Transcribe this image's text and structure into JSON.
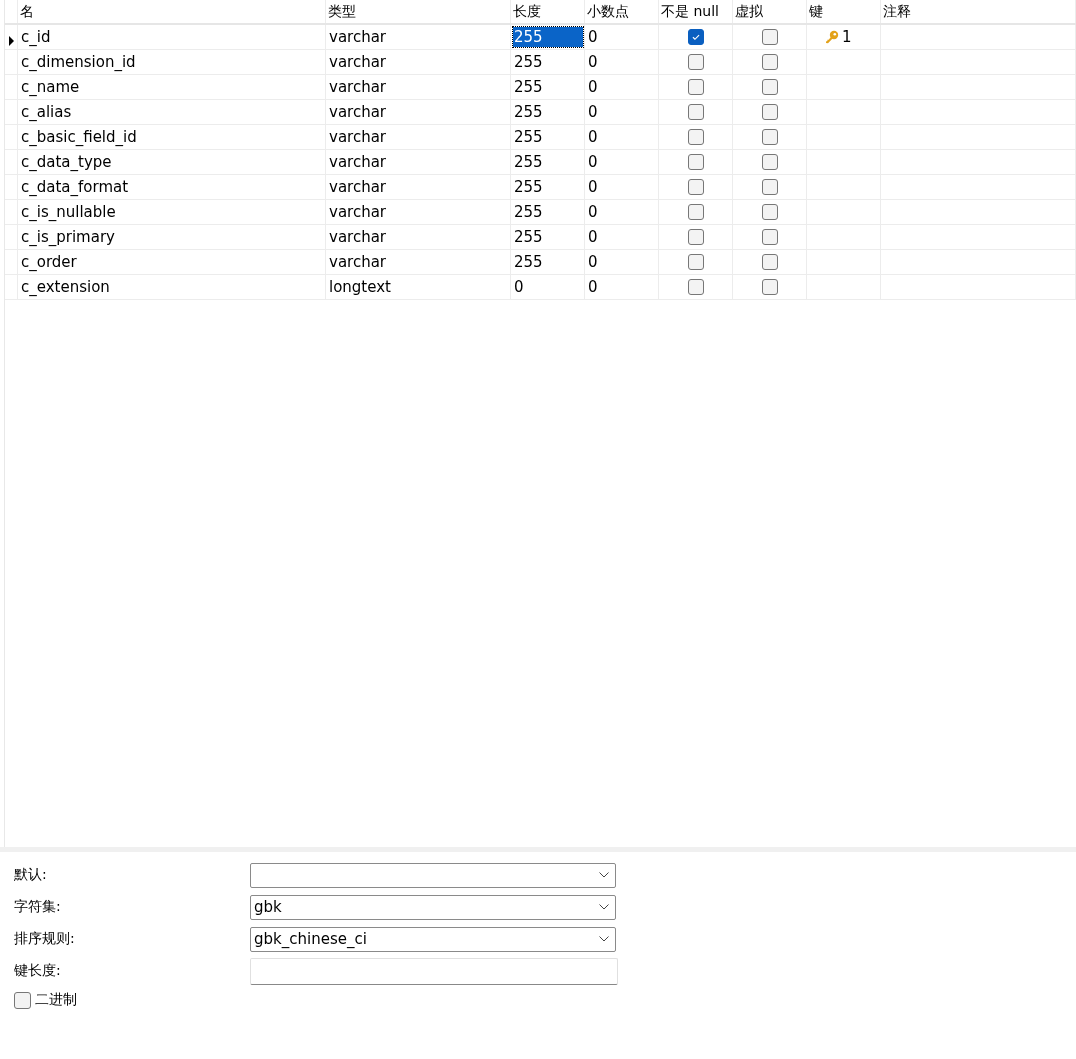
{
  "table": {
    "columns": [
      "名",
      "类型",
      "长度",
      "小数点",
      "不是 null",
      "虚拟",
      "键",
      "注释"
    ],
    "rows": [
      {
        "name": "c_id",
        "type": "varchar",
        "length": "255",
        "decimals": "0",
        "not_null": true,
        "virtual": false,
        "key": "1",
        "selected": true
      },
      {
        "name": "c_dimension_id",
        "type": "varchar",
        "length": "255",
        "decimals": "0",
        "not_null": false,
        "virtual": false,
        "selected": false
      },
      {
        "name": "c_name",
        "type": "varchar",
        "length": "255",
        "decimals": "0",
        "not_null": false,
        "virtual": false,
        "selected": false
      },
      {
        "name": "c_alias",
        "type": "varchar",
        "length": "255",
        "decimals": "0",
        "not_null": false,
        "virtual": false,
        "selected": false
      },
      {
        "name": "c_basic_field_id",
        "type": "varchar",
        "length": "255",
        "decimals": "0",
        "not_null": false,
        "virtual": false,
        "selected": false
      },
      {
        "name": "c_data_type",
        "type": "varchar",
        "length": "255",
        "decimals": "0",
        "not_null": false,
        "virtual": false,
        "selected": false
      },
      {
        "name": "c_data_format",
        "type": "varchar",
        "length": "255",
        "decimals": "0",
        "not_null": false,
        "virtual": false,
        "selected": false
      },
      {
        "name": "c_is_nullable",
        "type": "varchar",
        "length": "255",
        "decimals": "0",
        "not_null": false,
        "virtual": false,
        "selected": false
      },
      {
        "name": "c_is_primary",
        "type": "varchar",
        "length": "255",
        "decimals": "0",
        "not_null": false,
        "virtual": false,
        "selected": false
      },
      {
        "name": "c_order",
        "type": "varchar",
        "length": "255",
        "decimals": "0",
        "not_null": false,
        "virtual": false,
        "selected": false
      },
      {
        "name": "c_extension",
        "type": "longtext",
        "length": "0",
        "decimals": "0",
        "not_null": false,
        "virtual": false,
        "selected": false
      }
    ]
  },
  "properties": {
    "fields": [
      {
        "kind": "dropdown",
        "label": "默认:"
      },
      {
        "kind": "dropdown",
        "label": "字符集:",
        "value": "gbk"
      },
      {
        "kind": "dropdown",
        "label": "排序规则:",
        "value": "gbk_chinese_ci"
      },
      {
        "kind": "text",
        "label": "键长度:"
      }
    ],
    "checkbox": {
      "label": "二进制",
      "checked": false
    }
  }
}
